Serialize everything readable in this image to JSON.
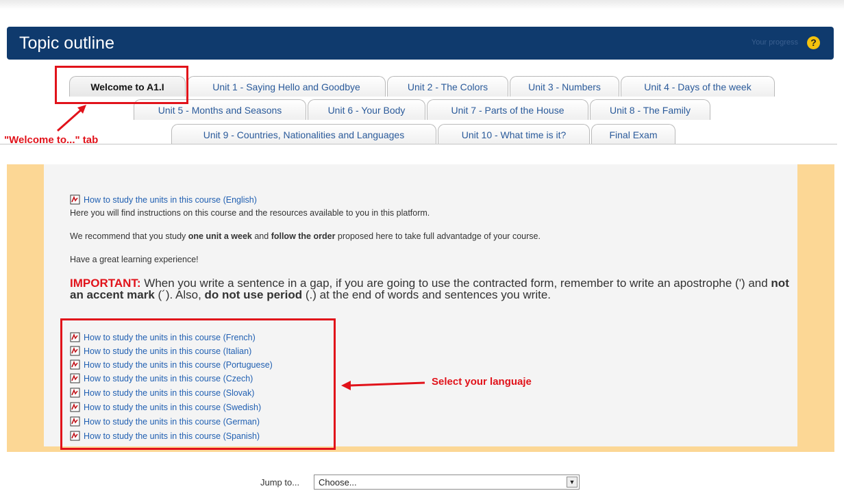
{
  "header": {
    "title": "Topic outline",
    "progress_label": "Your progress",
    "help_icon": "?"
  },
  "tabs": [
    {
      "label": "Welcome to A1.I",
      "active": true
    },
    {
      "label": "Unit 1 - Saying Hello and Goodbye"
    },
    {
      "label": "Unit 2 - The Colors"
    },
    {
      "label": "Unit 3 - Numbers"
    },
    {
      "label": "Unit 4 - Days of the week"
    },
    {
      "label": "Unit 5 - Months and Seasons"
    },
    {
      "label": "Unit 6 - Your Body"
    },
    {
      "label": "Unit 7 - Parts of the House"
    },
    {
      "label": "Unit 8 - The Family"
    },
    {
      "label": "Unit 9 - Countries, Nationalities and Languages"
    },
    {
      "label": "Unit 10 - What time is it?"
    },
    {
      "label": "Final Exam"
    }
  ],
  "annotations": {
    "welcome_tab_note": "\"Welcome to...\" tab",
    "select_language_note": "Select your languaje"
  },
  "content": {
    "main_link": "How to study the units in this course (English)",
    "intro": "Here you will find instructions on this course and the resources available to you in this platform.",
    "recommend_1": "We recommend that you study ",
    "recommend_2": "one unit a week",
    "recommend_3": " and ",
    "recommend_4": "follow the order",
    "recommend_5": " proposed here to take full advantadge of your course.",
    "greeting": "Have a great learning experience!",
    "important_label": "IMPORTANT:",
    "important_1": " When you write a sentence in a gap, if you are going to use the contracted form, remember to write an apostrophe (') and ",
    "important_2": "not an accent mark",
    "important_3": " (´). Also, ",
    "important_4": "do not use period",
    "important_5": " (.) at the end of words and sentences you write.",
    "language_links": [
      "How to study the units in this course (French)",
      "How to study the units in this course (Italian)",
      "How to study the units in this course (Portuguese)",
      "How to study the units in this course (Czech)",
      "How to study the units in this course (Slovak)",
      "How to study the units in this course (Swedish)",
      "How to study the units in this course (German)",
      "How to study the units in this course (Spanish)"
    ]
  },
  "footer": {
    "jump_label": "Jump to...",
    "jump_selected": "Choose..."
  },
  "colors": {
    "header_bg": "#0f3a6d",
    "annotation_red": "#e1121a",
    "content_border": "#fcd795",
    "link_blue": "#2160b2"
  }
}
